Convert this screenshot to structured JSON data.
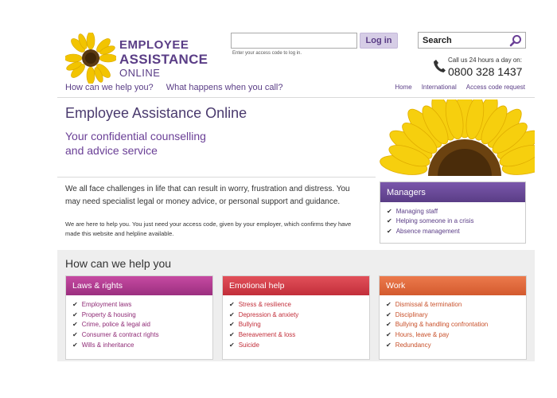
{
  "header": {
    "logo": {
      "line1": "EMPLOYEE",
      "line2": "ASSISTANCE",
      "line3": "ONLINE"
    },
    "access": {
      "input_value": "",
      "hint": "Enter your access code to log in.",
      "login_label": "Log in"
    },
    "search": {
      "label": "Search",
      "icon": "search-icon"
    },
    "phone": {
      "line1": "Call us 24 hours a day on:",
      "number": "0800 328 1437",
      "icon": "phone-icon"
    }
  },
  "nav": {
    "main": [
      "How can we help you?",
      "What happens when you call?"
    ],
    "secondary": [
      "Home",
      "International",
      "Access code request"
    ]
  },
  "hero": {
    "title": "Employee Assistance Online",
    "subtitle_line1": "Your confidential counselling",
    "subtitle_line2": "and advice service"
  },
  "intro": {
    "big": "We all face challenges in life that can result in worry, frustration and distress. You may need specialist legal or money advice, or personal support and guidance.",
    "small": "We are here to help you. You just need your access code, given by your employer, which confirms they have made this website and helpline available."
  },
  "managers": {
    "title": "Managers",
    "items": [
      "Managing staff",
      "Helping someone in a crisis",
      "Absence management"
    ]
  },
  "help": {
    "title": "How can we help you",
    "cards": [
      {
        "title": "Laws & rights",
        "items": [
          "Employment laws",
          "Property & housing",
          "Crime, police & legal aid",
          "Consumer & contract rights",
          "Wills & inheritance"
        ]
      },
      {
        "title": "Emotional help",
        "items": [
          "Stress & resilience",
          "Depression & anxiety",
          "Bullying",
          "Bereavement & loss",
          "Suicide"
        ]
      },
      {
        "title": "Work",
        "items": [
          "Dismissal & termination",
          "Disciplinary",
          "Bullying & handling confrontation",
          "Hours, leave & pay",
          "Redundancy"
        ]
      }
    ]
  },
  "colors": {
    "brand_purple": "#5a3d86",
    "laws_magenta": "#9b2f7f",
    "emotional_red": "#c22e3a",
    "work_orange": "#d35a2e"
  }
}
